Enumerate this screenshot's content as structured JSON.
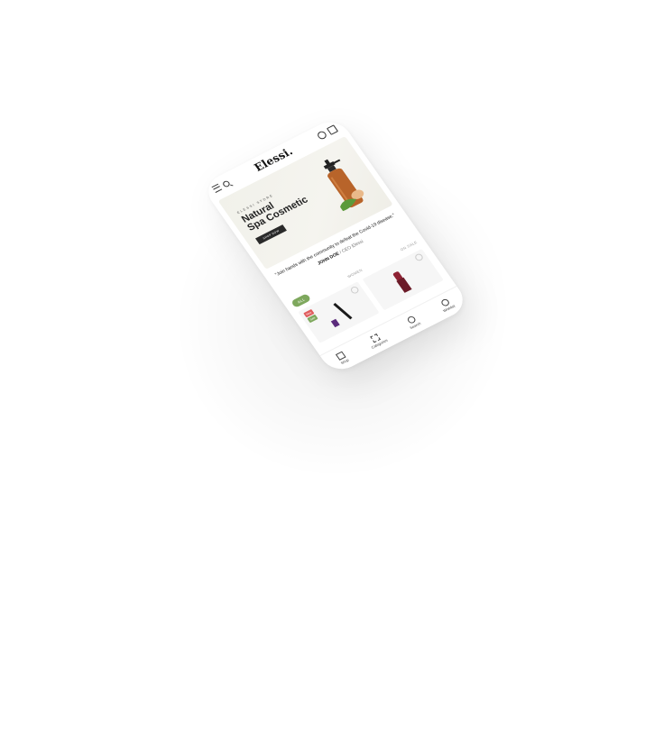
{
  "header": {
    "logo_text": "Elessi.",
    "menu_icon": "hamburger-menu-icon",
    "search_icon": "search-icon",
    "account_icon": "user-icon",
    "cart_icon": "shopping-bag-icon"
  },
  "hero": {
    "kicker": "ELESSI STORE",
    "title_line1": "Natural",
    "title_line2": "Spa Cosmetic",
    "cta_label": "SHOP NOW"
  },
  "testimonial": {
    "quote": "\"Join hands with the community to defeat the Covid-19 disease.\"",
    "author_name": "JOHN DOE",
    "author_separator": " / ",
    "author_role": "CEO Elessi"
  },
  "tabs": [
    {
      "label": "ALL",
      "active": true
    },
    {
      "label": "WOMEN",
      "active": false
    },
    {
      "label": "ON SALE",
      "active": false
    }
  ],
  "products": [
    {
      "badges": [
        "New",
        "Sale"
      ],
      "image": "mascara-and-nail-polish"
    },
    {
      "badges": [],
      "image": "lipstick"
    }
  ],
  "bottom_nav": [
    {
      "label": "Shop",
      "icon": "home-icon"
    },
    {
      "label": "Categories",
      "icon": "grid-icon"
    },
    {
      "label": "Search",
      "icon": "search-icon"
    },
    {
      "label": "Wishlist",
      "icon": "heart-icon"
    }
  ],
  "colors": {
    "accent_green": "#7ea85d",
    "badge_red": "#e05d5d",
    "hero_bg": "#f1f1ea",
    "bottle_amber": "#b8642a"
  }
}
